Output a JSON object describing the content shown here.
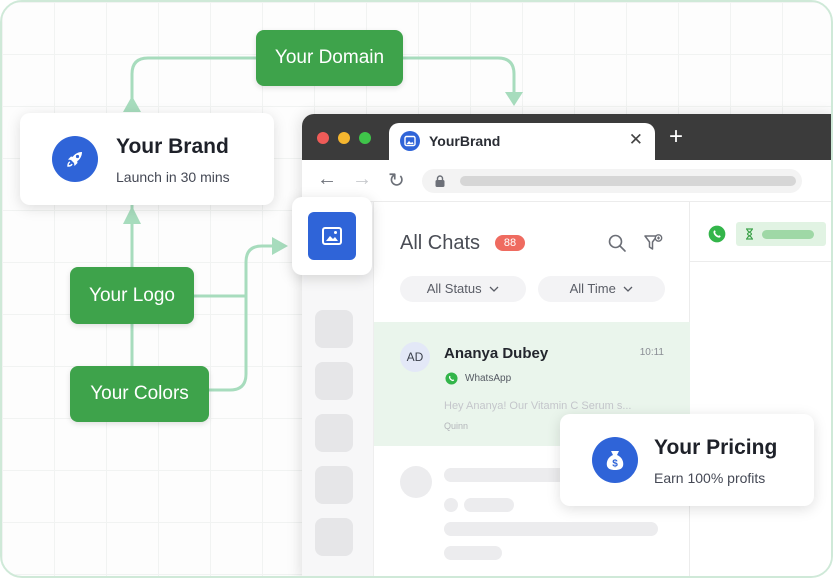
{
  "flow": {
    "domain_label": "Your Domain",
    "logo_label": "Your Logo",
    "colors_label": "Your Colors"
  },
  "brand_card": {
    "title": "Your Brand",
    "subtitle": "Launch in 30 mins",
    "icon": "rocket-icon"
  },
  "pricing_card": {
    "title": "Your Pricing",
    "subtitle": "Earn 100% profits",
    "icon": "money-bag-icon"
  },
  "browser": {
    "tab_title": "YourBrand",
    "tab_close": "✕",
    "new_tab": "+",
    "nav": {
      "back": "←",
      "forward": "→",
      "reload": "↻"
    }
  },
  "chats": {
    "title": "All Chats",
    "count": "88",
    "filters": {
      "status": "All Status",
      "time": "All Time"
    },
    "selected": {
      "initials": "AD",
      "name": "Ananya Dubey",
      "time": "10:11",
      "channel": "WhatsApp",
      "preview": "Hey Ananya! Our Vitamin C Serum s...",
      "agent": "Quinn"
    }
  },
  "colors": {
    "brand_green": "#3ea34b",
    "brand_blue": "#2f64d8",
    "connector": "#a7dcbd",
    "badge": "#ef6b60",
    "selected_row": "#eaf5ec"
  }
}
